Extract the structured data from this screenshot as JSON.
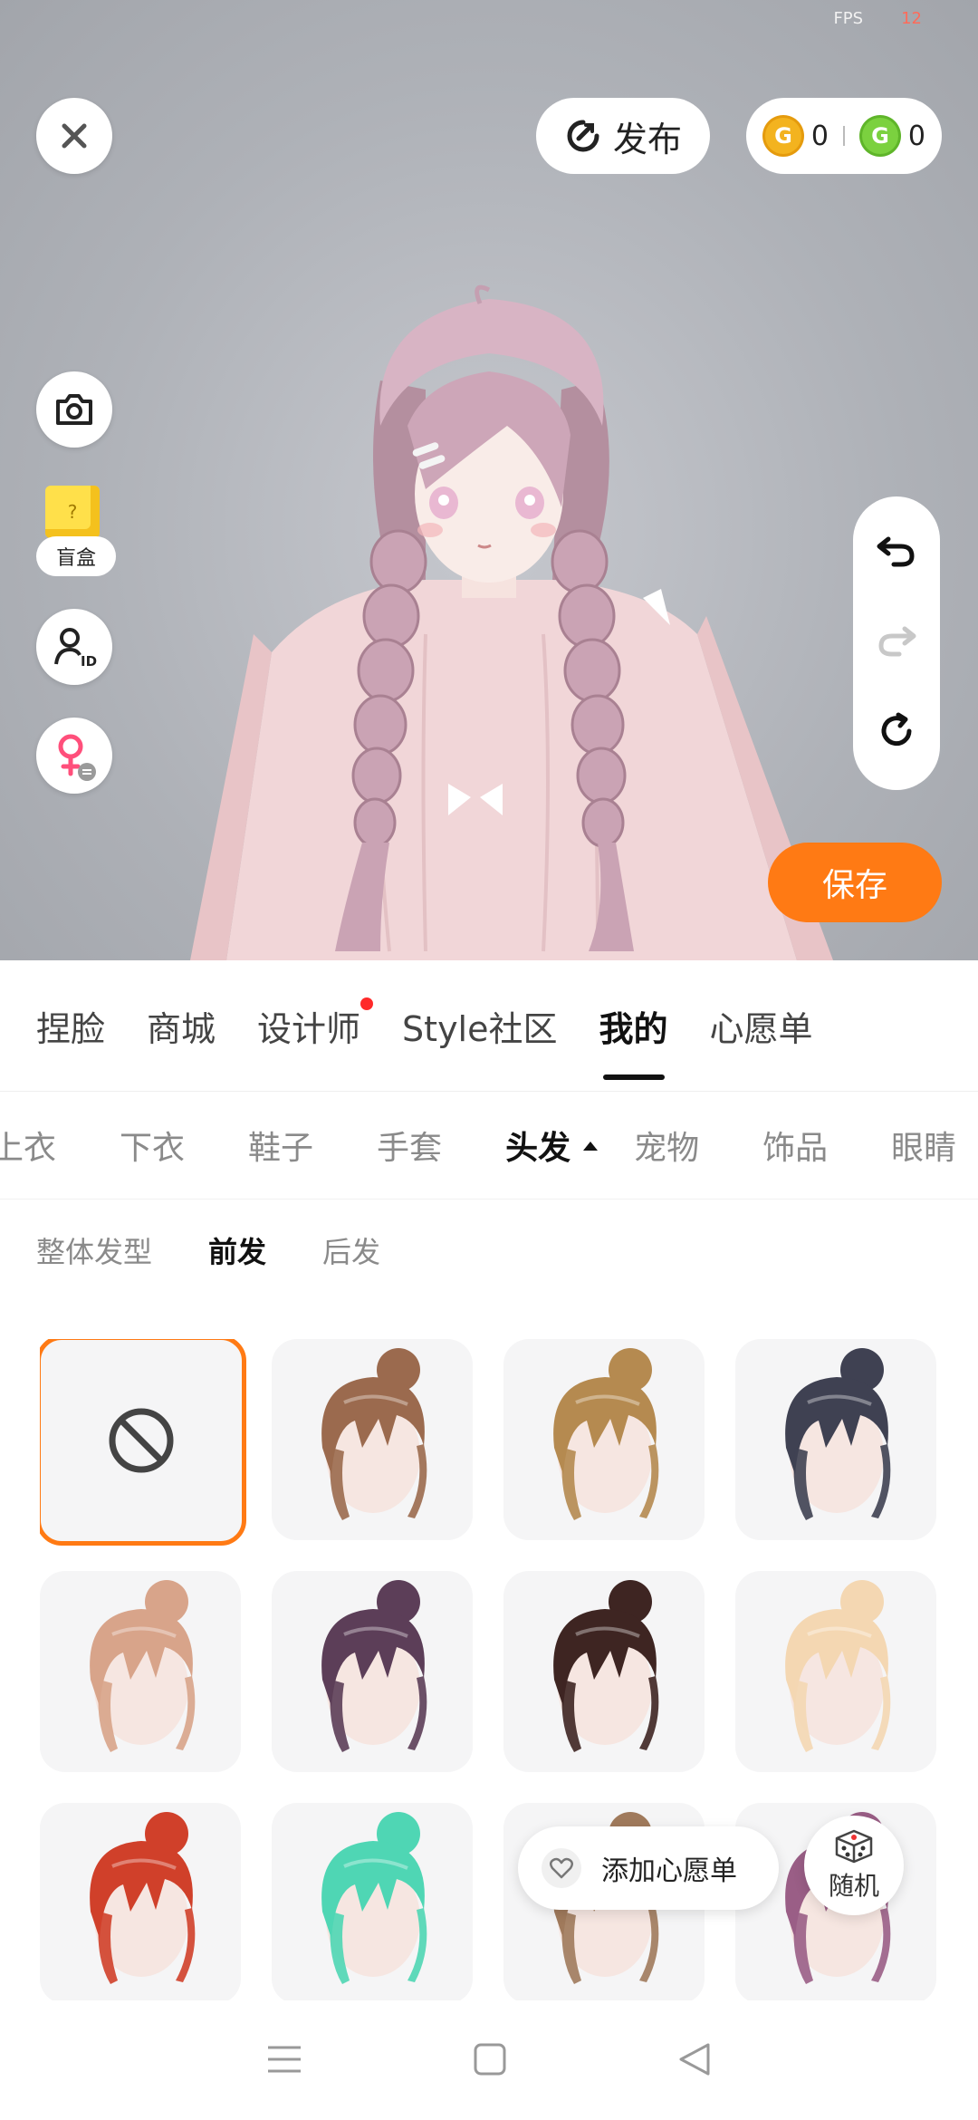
{
  "status": {
    "fps_label": "FPS",
    "fps_value": "12"
  },
  "header": {
    "publish_label": "发布",
    "coins": [
      {
        "icon": "gold-coin-icon",
        "letter": "G",
        "value": "0",
        "color": "#f3b31f"
      },
      {
        "icon": "green-coin-icon",
        "letter": "G",
        "value": "0",
        "color": "#7bd13f"
      }
    ]
  },
  "left_tools": {
    "blind_box_label": "盲盒",
    "blind_box_mark": "?"
  },
  "save_label": "保存",
  "main_tabs": [
    {
      "label": "捏脸",
      "active": false,
      "dot": false
    },
    {
      "label": "商城",
      "active": false,
      "dot": false
    },
    {
      "label": "设计师",
      "active": false,
      "dot": true
    },
    {
      "label": "Style社区",
      "active": false,
      "dot": false
    },
    {
      "label": "我的",
      "active": true,
      "dot": false
    },
    {
      "label": "心愿单",
      "active": false,
      "dot": false
    }
  ],
  "category_tabs": [
    {
      "label": "上衣",
      "active": false
    },
    {
      "label": "下衣",
      "active": false
    },
    {
      "label": "鞋子",
      "active": false
    },
    {
      "label": "手套",
      "active": false
    },
    {
      "label": "头发",
      "active": true
    },
    {
      "label": "宠物",
      "active": false
    },
    {
      "label": "饰品",
      "active": false
    },
    {
      "label": "眼睛",
      "active": false
    }
  ],
  "sub_tabs": [
    {
      "label": "整体发型",
      "active": false
    },
    {
      "label": "前发",
      "active": true
    },
    {
      "label": "后发",
      "active": false
    }
  ],
  "hair_items": [
    {
      "name": "none",
      "color": "",
      "selected": true
    },
    {
      "name": "hair-brown-bun",
      "color": "#9b6a4e",
      "selected": false
    },
    {
      "name": "hair-tan-bun",
      "color": "#b58a50",
      "selected": false
    },
    {
      "name": "hair-navy-bun",
      "color": "#3f4152",
      "selected": false
    },
    {
      "name": "hair-peach-bun",
      "color": "#d8a48a",
      "selected": false
    },
    {
      "name": "hair-plum-bun",
      "color": "#5c3e58",
      "selected": false
    },
    {
      "name": "hair-darkbrown-bun",
      "color": "#3e2522",
      "selected": false
    },
    {
      "name": "hair-blonde-bun",
      "color": "#f4d7b2",
      "selected": false
    },
    {
      "name": "hair-red-bun",
      "color": "#d0402a",
      "selected": false
    },
    {
      "name": "hair-mint-bun",
      "color": "#4fd6b4",
      "selected": false
    },
    {
      "name": "hair-lightbrown-bun",
      "color": "#a07a5c",
      "selected": false
    },
    {
      "name": "hair-mauve-bun",
      "color": "#9a5e86",
      "selected": false
    }
  ],
  "wishlist_label": "添加心愿单",
  "random_label": "随机",
  "colors": {
    "accent": "#ff7a14",
    "dot": "#ff2a2a"
  }
}
